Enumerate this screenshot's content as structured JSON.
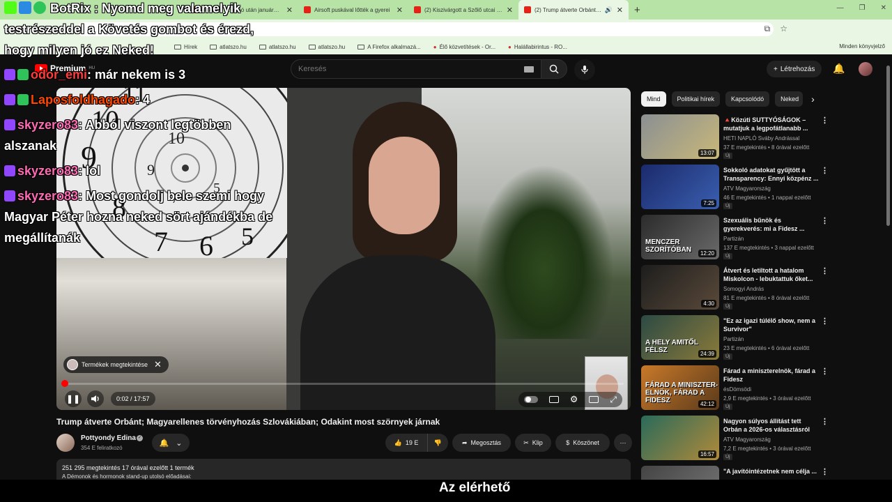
{
  "browser": {
    "tabs": [
      {
        "title": "4 év és 62 millió után januárban"
      },
      {
        "title": "Airsoft puskával lőtték a gyerei"
      },
      {
        "title": "(2) Kiszivárgott a Szőlő utcai javí"
      },
      {
        "title": "(2) Trump átverte Orbánt; M"
      }
    ],
    "bookmarks": [
      "Hírek",
      "atlatszo.hu",
      "atlatszo.hu",
      "atlatszo.hu",
      "A Firefox alkalmazá...",
      "Élő közvetítések - Or...",
      "Halállabirintus - RO..."
    ],
    "bookmarks_right": "Minden könyvjelző"
  },
  "yt": {
    "logo": "Premium",
    "logo_region": "HU",
    "search_placeholder": "Keresés",
    "create_label": "Létrehozás"
  },
  "player": {
    "product_chip": "Termékek megtekintése",
    "time": "0:02 / 17:57",
    "progress": 0.002
  },
  "video": {
    "title": "Trump átverte Orbánt; Magyarellenes törvényhozás Szlovákiában; Odakint most szörnyek járnak",
    "channel": "Pottyondy Edina",
    "subs": "354 E feliratkozó",
    "likes": "19 E",
    "share": "Megosztás",
    "clip": "Klip",
    "thanks": "Köszönet",
    "desc_meta": "251 295 megtekintés  17 órával ezelőtt  1 termék",
    "desc_text": "A Démonok és hormonok stand-up utolsó előadásai:"
  },
  "chips": [
    "Mind",
    "Politikai hírek",
    "Kapcsolódó",
    "Neked"
  ],
  "recs": [
    {
      "title": "🔺Közúti SUTTYÓSÁGOK – mutatjuk a legpofátlanabb ...",
      "channel": "HETI NAPLÓ Sváby Andrással",
      "meta": "37 E megtekintés • 8 órával ezelőtt",
      "badge": "Új",
      "duration": "13:07",
      "thumb": "",
      "c1": "#8a8f92",
      "c2": "#c9b87a"
    },
    {
      "title": "Sokkoló adatokat gyűjtött a Transparency: Ennyi közpénz ...",
      "channel": "ATV Magyarország",
      "meta": "46 E megtekintés • 1 nappal ezelőtt",
      "badge": "Új",
      "duration": "7:25",
      "thumb": "",
      "c1": "#1b2a6b",
      "c2": "#3a5fb0"
    },
    {
      "title": "Szexuális bűnök és gyerekverés: mi a Fidesz ...",
      "channel": "Partizán",
      "meta": "137 E megtekintés • 3 nappal ezelőtt",
      "badge": "Új",
      "duration": "12:20",
      "thumb": "MENCZER SZORÍTÓBAN",
      "c1": "#2b2b2b",
      "c2": "#6a6a6a"
    },
    {
      "title": "Átvert és letiltott a hatalom Miskolcon - lebuktattuk őket...",
      "channel": "Somogyi András",
      "meta": "81 E megtekintés • 8 órával ezelőtt",
      "badge": "Új",
      "duration": "4:30",
      "thumb": "",
      "c1": "#1d1d1d",
      "c2": "#5a4a3a"
    },
    {
      "title": "\"Ez az igazi túlélő show, nem a Survivor\"",
      "channel": "Partizán",
      "meta": "23 E megtekintés • 6 órával ezelőtt",
      "badge": "Új",
      "duration": "24:39",
      "thumb": "A HELY AMITŐL FÉLSZ",
      "c1": "#2c4a44",
      "c2": "#8a7a3a"
    },
    {
      "title": "Fárad a miniszterelnök, fárad a Fidesz",
      "channel": "ésDömsödi",
      "meta": "2,9 E megtekintés • 3 órával ezelőtt",
      "badge": "Új",
      "duration": "42:12",
      "thumb": "FÁRAD A MINISZTER-ELNÖK, FÁRAD A FIDESZ",
      "c1": "#c9792a",
      "c2": "#5a3a1a"
    },
    {
      "title": "Nagyon súlyos állítást tett Orbán a 2026-os választásról",
      "channel": "ATV Magyarország",
      "meta": "7,2 E megtekintés • 3 órával ezelőtt",
      "badge": "Új",
      "duration": "16:57",
      "thumb": "",
      "c1": "#2a6a5a",
      "c2": "#b08a3a"
    },
    {
      "title": "\"A javítóintézetnek nem célja ...",
      "channel": "",
      "meta": "",
      "badge": "",
      "duration": "",
      "thumb": "",
      "c1": "#444",
      "c2": "#777"
    }
  ],
  "subtitle": "Az elérhető",
  "chat": {
    "header": "BotRix : Nyomd meg valamelyik testrészeddel a Követés gombot és érezd, hogy milyen jó ez Neked!",
    "header_lines": [
      "BotRix : Nyomd meg valamelyik",
      "testrészeddel a Követés gombot és érezd,",
      "hogy milyen jó ez Neked!"
    ],
    "messages": [
      {
        "user": "odor_emi",
        "text": ": már nekem is 3"
      },
      {
        "user": "Laposfoldhagado",
        "text": ": 4"
      },
      {
        "user": "skyzero83",
        "text": ": Abból viszont legtöbben"
      },
      {
        "user": "",
        "text": "alszanak"
      },
      {
        "user": "skyzero83",
        "text": ": lol"
      },
      {
        "user": "skyzero83",
        "text": ": Most gondolj bele szemi hogy"
      },
      {
        "user": "",
        "text": "Magyar Péter hozna neked sört ajándékba de"
      },
      {
        "user": "",
        "text": "megállítanák"
      }
    ]
  }
}
